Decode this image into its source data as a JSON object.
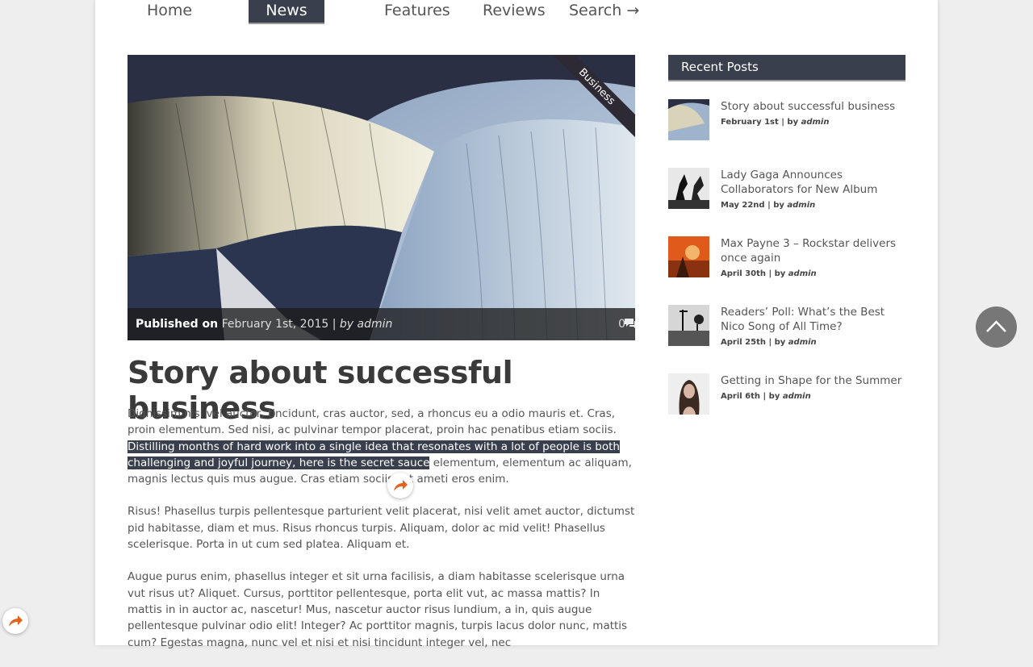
{
  "nav": {
    "items": [
      "Home",
      "News",
      "Features",
      "Reviews",
      "Search →"
    ],
    "active_index": 1
  },
  "article": {
    "category": "Business",
    "published_label": "Published on",
    "published_date": "February 1st, 2015",
    "separator": "|",
    "by_label": "by",
    "author": "admin",
    "comment_count": "0",
    "title": "Story about successful business",
    "para1_start": "Dignissim nisi vel auctor, tincidunt, cras auctor, sed, a rhoncus eu a odio mauris et. Cras, proin elementum. Sed nisi, ac pulvinar tempor placerat, proin hac penatibus etiam sociis.",
    "para1_highlight": "Distilling months of hard work into a single idea that resonates with a lot of people is both challenging and joyful journey, here is the secret sauce",
    "para1_end": " elementum, elementum ac aliquam, magnis lectus quis mus augue. Cras etiam sociis est ameti eros enim.",
    "para2": "Risus! Phasellus turpis pellentesque parturient velit placerat, nisi velit amet auctor, dictumst pid habitasse, diam et mus. Risus rhoncus turpis. Aliquam, dolor ac mid velit! Phasellus scelerisque. Porta in ut cum sed platea. Aliquam et.",
    "para3": "Augue purus enim, phasellus integer et sit urna facilisis, a diam habitasse scelerisque urna vut risus ut? Aliquet. Cursus, porttitor pellentesque, porta elit vut, ac massa mattis? In mattis in in auctor ac, nascetur! Mus, nascetur auctor risus lundium, a in, quis augue pellentesque pulvinar odio elit! Integer? Ac porttitor magnis, turpis lacus dolor nunc, mattis cum? Egestas magna, nunc vel et nisi et nisi tincidunt integer vel, nec"
  },
  "sidebar": {
    "heading": "Recent Posts",
    "posts": [
      {
        "title": "Story about successful business",
        "date": "February 1st",
        "by": "by",
        "author": "admin"
      },
      {
        "title": "Lady Gaga Announces Collaborators for New Album",
        "date": "May 22nd",
        "by": "by",
        "author": "admin"
      },
      {
        "title": "Max Payne 3 – Rockstar delivers once again",
        "date": "April 30th",
        "by": "by",
        "author": "admin"
      },
      {
        "title": "Readers’ Poll: What’s the Best Nico Song of All Time?",
        "date": "April 25th",
        "by": "by",
        "author": "admin"
      },
      {
        "title": "Getting in Shape for the Summer",
        "date": "April 6th",
        "by": "by",
        "author": "admin"
      }
    ]
  },
  "icons": {
    "comment": "speech-bubble-icon",
    "share": "share-arrow-icon",
    "back_to_top": "chevron-up-icon"
  },
  "colors": {
    "accent_dark": "#3a3f4d",
    "share_orange": "#e2631c"
  }
}
